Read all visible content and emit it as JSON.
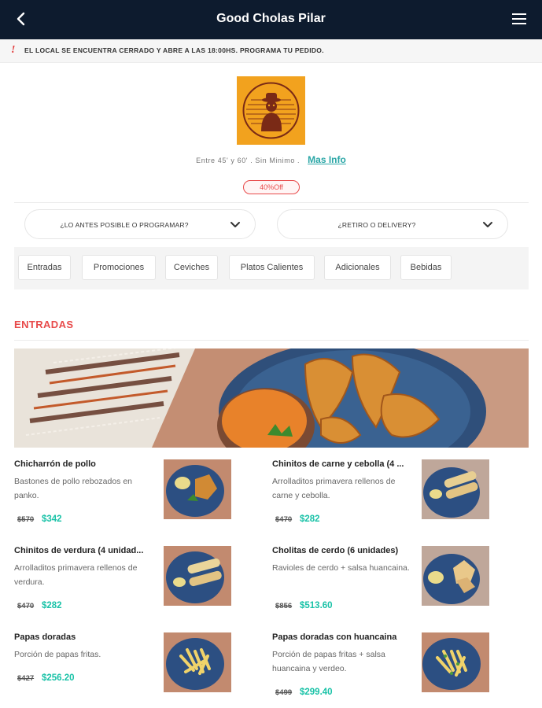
{
  "header": {
    "title": "Good Cholas Pilar",
    "back_icon": "chevron-left-icon",
    "menu_icon": "hamburger-menu-icon"
  },
  "notice": {
    "icon": "!",
    "text": "EL LOCAL SE ENCUENTRA CERRADO Y ABRE A LAS 18:00HS. PROGRAMA TU PEDIDO."
  },
  "store": {
    "delivery_info": "Entre 45' y 60' . Sin Minimo .",
    "more_info_label": "Mas Info",
    "discount_badge": "40%Off"
  },
  "selectors": {
    "timing": "¿LO ANTES POSIBLE O PROGRAMAR?",
    "mode": "¿RETIRO O DELIVERY?"
  },
  "categories": [
    "Entradas",
    "Promociones",
    "Ceviches",
    "Platos Calientes",
    "Adicionales",
    "Bebidas"
  ],
  "section": {
    "title": "ENTRADAS"
  },
  "items": [
    {
      "name": "Chicharrón de pollo",
      "desc": "Bastones de pollo rebozados en panko.",
      "old_price": "$570",
      "price": "$342"
    },
    {
      "name": "Chinitos de carne y cebolla (4 ...",
      "desc": "Arrolladitos primavera rellenos de carne y cebolla.",
      "old_price": "$470",
      "price": "$282"
    },
    {
      "name": "Chinitos de verdura (4 unidad...",
      "desc": "Arrolladitos primavera rellenos de verdura.",
      "old_price": "$470",
      "price": "$282"
    },
    {
      "name": "Cholitas de cerdo (6 unidades)",
      "desc": "Ravioles de cerdo + salsa huancaina.",
      "old_price": "$856",
      "price": "$513.60"
    },
    {
      "name": "Papas doradas",
      "desc": "Porción de papas fritas.",
      "old_price": "$427",
      "price": "$256.20"
    },
    {
      "name": "Papas doradas con huancaina",
      "desc": "Porción de papas fritas + salsa huancaina y verdeo.",
      "old_price": "$499",
      "price": "$299.40"
    }
  ],
  "colors": {
    "header_bg": "#0d1b2e",
    "accent_red": "#e84a4a",
    "price_green": "#19c2a7",
    "link_teal": "#2aa6a6",
    "logo_bg": "#f2a21e"
  }
}
